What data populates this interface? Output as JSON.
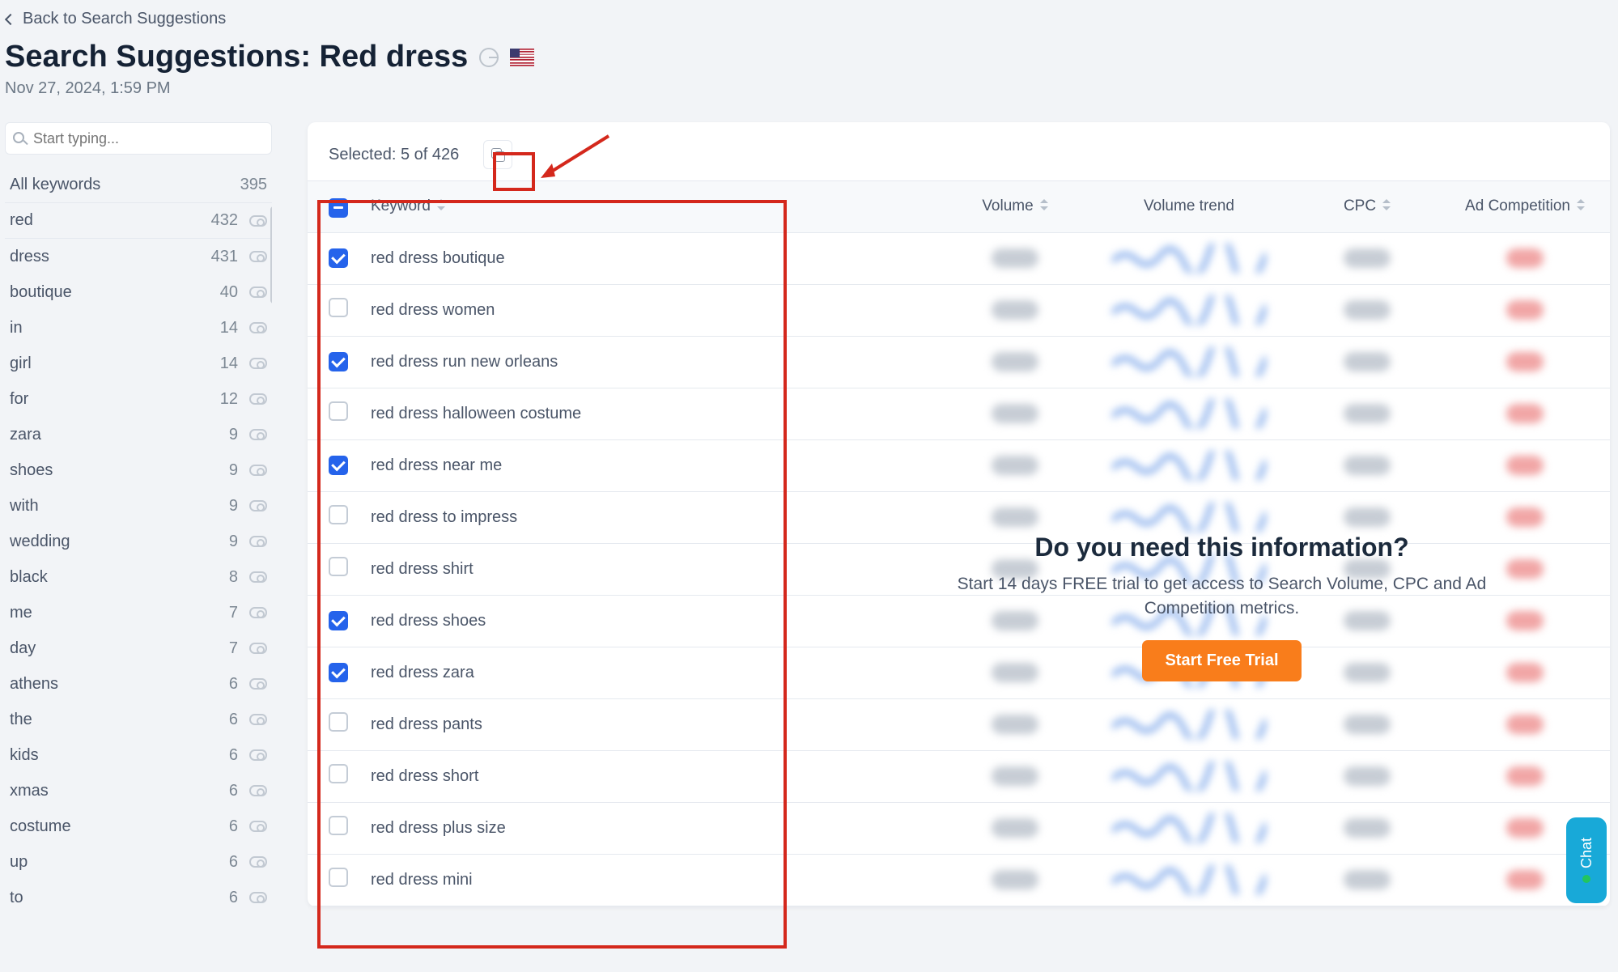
{
  "header": {
    "back_label": "Back to Search Suggestions",
    "title_prefix": "Search Suggestions: ",
    "title_query": "Red dress",
    "timestamp": "Nov 27, 2024, 1:59 PM"
  },
  "sidebar": {
    "search_placeholder": "Start typing...",
    "all_label": "All keywords",
    "all_count": "395",
    "items": [
      {
        "label": "red",
        "count": "432"
      },
      {
        "label": "dress",
        "count": "431"
      },
      {
        "label": "boutique",
        "count": "40"
      },
      {
        "label": "in",
        "count": "14"
      },
      {
        "label": "girl",
        "count": "14"
      },
      {
        "label": "for",
        "count": "12"
      },
      {
        "label": "zara",
        "count": "9"
      },
      {
        "label": "shoes",
        "count": "9"
      },
      {
        "label": "with",
        "count": "9"
      },
      {
        "label": "wedding",
        "count": "9"
      },
      {
        "label": "black",
        "count": "8"
      },
      {
        "label": "me",
        "count": "7"
      },
      {
        "label": "day",
        "count": "7"
      },
      {
        "label": "athens",
        "count": "6"
      },
      {
        "label": "the",
        "count": "6"
      },
      {
        "label": "kids",
        "count": "6"
      },
      {
        "label": "xmas",
        "count": "6"
      },
      {
        "label": "costume",
        "count": "6"
      },
      {
        "label": "up",
        "count": "6"
      },
      {
        "label": "to",
        "count": "6"
      }
    ]
  },
  "table": {
    "selected_label": "Selected: 5 of 426",
    "headers": {
      "keyword": "Keyword",
      "volume": "Volume",
      "volume_trend": "Volume trend",
      "cpc": "CPC",
      "ad_competition": "Ad Competition"
    },
    "rows": [
      {
        "keyword": "red dress boutique",
        "checked": true
      },
      {
        "keyword": "red dress women",
        "checked": false
      },
      {
        "keyword": "red dress run new orleans",
        "checked": true
      },
      {
        "keyword": "red dress halloween costume",
        "checked": false
      },
      {
        "keyword": "red dress near me",
        "checked": true
      },
      {
        "keyword": "red dress to impress",
        "checked": false
      },
      {
        "keyword": "red dress shirt",
        "checked": false
      },
      {
        "keyword": "red dress shoes",
        "checked": true
      },
      {
        "keyword": "red dress zara",
        "checked": true
      },
      {
        "keyword": "red dress pants",
        "checked": false
      },
      {
        "keyword": "red dress short",
        "checked": false
      },
      {
        "keyword": "red dress plus size",
        "checked": false
      },
      {
        "keyword": "red dress mini",
        "checked": false
      }
    ]
  },
  "paywall": {
    "heading": "Do you need this information?",
    "text": "Start 14 days FREE trial to get access to Search Volume, CPC and Ad Competition metrics.",
    "cta": "Start Free Trial"
  },
  "chat": {
    "label": "Chat"
  }
}
